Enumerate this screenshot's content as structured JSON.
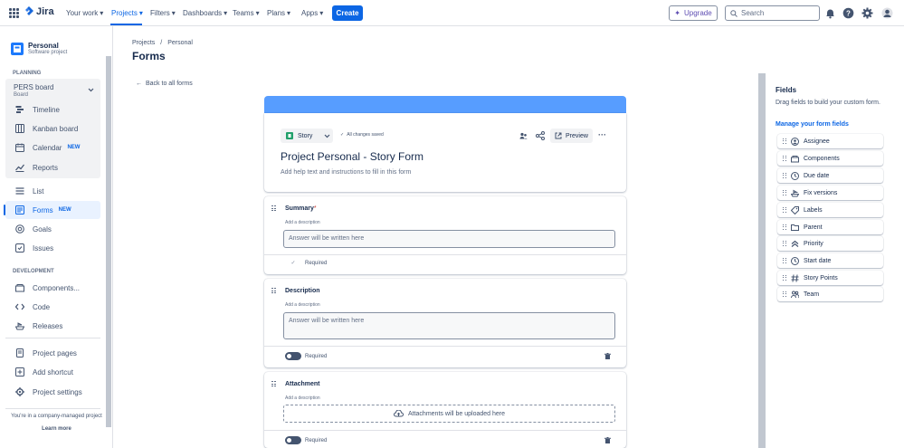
{
  "topnav": {
    "logo_text": "Jira",
    "items": [
      "Your work",
      "Projects",
      "Filters",
      "Dashboards",
      "Teams",
      "Plans",
      "Apps"
    ],
    "create_label": "Create",
    "upgrade_label": "Upgrade",
    "search_placeholder": "Search"
  },
  "sidebar": {
    "project_name": "Personal",
    "project_type": "Software project",
    "planning_label": "PLANNING",
    "board_title": "PERS board",
    "board_sub": "Board",
    "board_items": [
      "Timeline",
      "Kanban board",
      "Calendar",
      "Reports"
    ],
    "calendar_badge": "NEW",
    "items": [
      "List",
      "Forms",
      "Goals",
      "Issues"
    ],
    "forms_badge": "NEW",
    "development_label": "DEVELOPMENT",
    "dev_items": [
      "Components...",
      "Code",
      "Releases"
    ],
    "bottom_items": [
      "Project pages",
      "Add shortcut",
      "Project settings"
    ],
    "footer_text": "You're in a company-managed project",
    "learn_more": "Learn more"
  },
  "main": {
    "breadcrumb": [
      "Projects",
      "/",
      "Personal"
    ],
    "title": "Forms",
    "back_link": "Back to all forms"
  },
  "form": {
    "issue_type": "Story",
    "saved_status": "All changes saved",
    "preview_label": "Preview",
    "title": "Project Personal - Story Form",
    "help_text": "Add help text and instructions to fill in this form",
    "fields": [
      {
        "title": "Summary",
        "required_star": "*",
        "desc": "Add a description",
        "placeholder": "Answer will be written here",
        "required_label": "Required"
      },
      {
        "title": "Description",
        "desc": "Add a description",
        "placeholder": "Answer will be written here",
        "required_label": "Required"
      },
      {
        "title": "Attachment",
        "desc": "Add a description",
        "placeholder": "Attachments will be uploaded here",
        "required_label": "Required"
      }
    ]
  },
  "fields_panel": {
    "title": "Fields",
    "help": "Drag fields to build your custom form.",
    "manage_link": "Manage your form fields",
    "items": [
      {
        "label": "Assignee",
        "icon": "person-circle-icon"
      },
      {
        "label": "Components",
        "icon": "component-icon"
      },
      {
        "label": "Due date",
        "icon": "clock-icon"
      },
      {
        "label": "Fix versions",
        "icon": "ship-icon"
      },
      {
        "label": "Labels",
        "icon": "tag-icon"
      },
      {
        "label": "Parent",
        "icon": "folder-icon"
      },
      {
        "label": "Priority",
        "icon": "priority-icon"
      },
      {
        "label": "Start date",
        "icon": "clock-icon"
      },
      {
        "label": "Story Points",
        "icon": "hash-icon"
      },
      {
        "label": "Team",
        "icon": "team-icon"
      }
    ]
  },
  "colors": {
    "accent": "#0c66e4",
    "banner": "#579dff",
    "story": "#22a06b"
  }
}
